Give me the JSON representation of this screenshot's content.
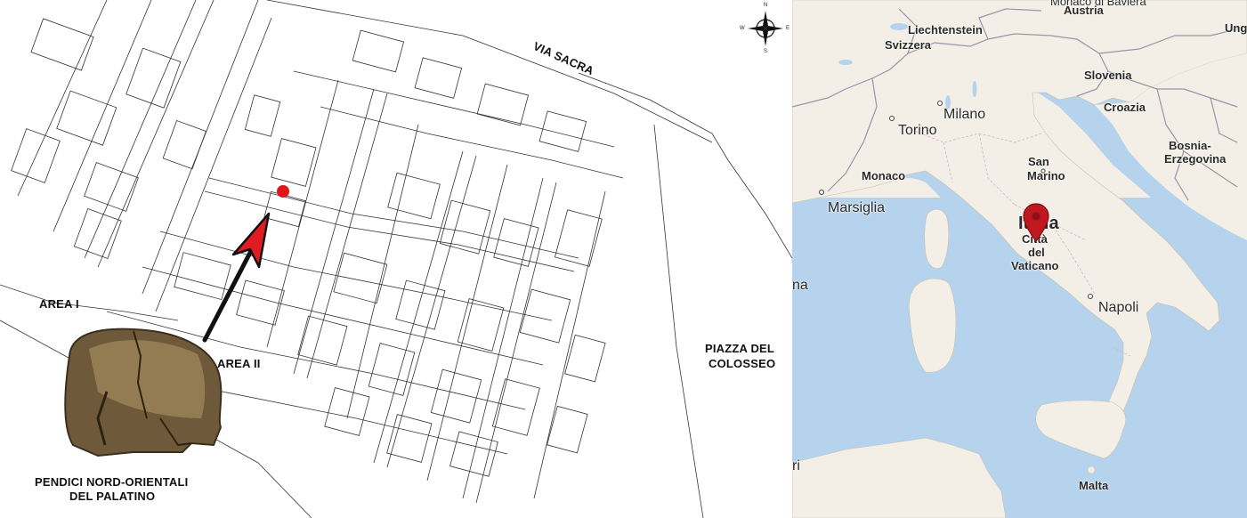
{
  "plan": {
    "labels": {
      "via_sacra": "VIA SACRA",
      "area_i": "AREA I",
      "area_ii": "AREA II",
      "piazza_line1": "PIAZZA DEL",
      "piazza_line2": "COLOSSEO",
      "pendici_line1": "PENDICI NORD-ORIENTALI",
      "pendici_line2": "DEL PALATINO"
    },
    "compass": {
      "n": "N",
      "s": "S",
      "e": "E",
      "w": "W"
    },
    "find_spot_color": "#e0161c",
    "arrow_head_color": "#e01b22"
  },
  "map": {
    "colors": {
      "sea": "#b5d3ec",
      "land": "#f3efe6",
      "border": "#9a93a8",
      "marker": "#c0181f"
    },
    "labels": {
      "monaco_baviera": "Monaco di Baviera",
      "austria": "Austria",
      "liechtenstein": "Liechtenstein",
      "svizzera": "Svizzera",
      "ung": "Ung",
      "milano": "Milano",
      "torino": "Torino",
      "slovenia": "Slovenia",
      "croazia": "Croazia",
      "bosnia_1": "Bosnia-",
      "bosnia_2": "Erzegovina",
      "san_marino_1": "San",
      "san_marino_2": "Marino",
      "monaco": "Monaco",
      "marsiglia": "Marsiglia",
      "italia": "Italia",
      "vaticano_1": "Città",
      "vaticano_2": "del",
      "vaticano_3": "Vaticano",
      "napoli": "Napoli",
      "na": "na",
      "ri": "ri",
      "malta": "Malta"
    }
  }
}
